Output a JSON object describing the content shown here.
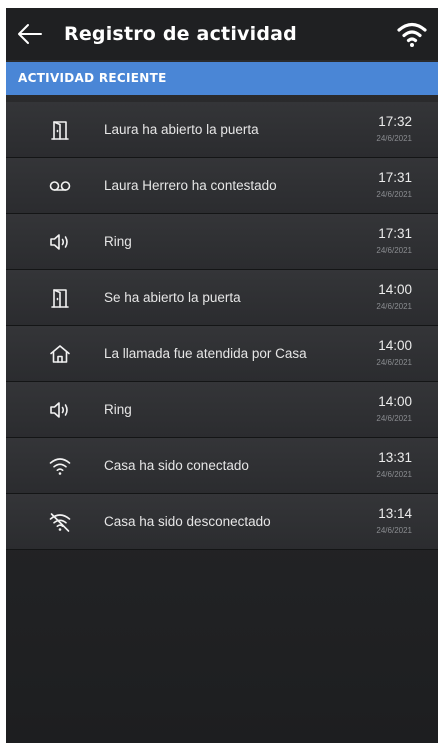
{
  "header": {
    "title": "Registro de actividad",
    "back_icon": "back-arrow-icon",
    "status_icon": "wifi-icon"
  },
  "section": {
    "label": "ACTIVIDAD RECIENTE"
  },
  "colors": {
    "header_bg": "#1f2022",
    "section_bg": "#4a86d6",
    "row_bg": "#303134",
    "text": "#e6e6e6",
    "date_text": "#8a8c90"
  },
  "activity": [
    {
      "icon": "door-open-icon",
      "message": "Laura ha abierto la puerta",
      "time": "17:32",
      "date": "24/6/2021"
    },
    {
      "icon": "voicemail-icon",
      "message": "Laura Herrero ha contestado",
      "time": "17:31",
      "date": "24/6/2021"
    },
    {
      "icon": "speaker-icon",
      "message": "Ring",
      "time": "17:31",
      "date": "24/6/2021"
    },
    {
      "icon": "door-open-icon",
      "message": "Se ha abierto la puerta",
      "time": "14:00",
      "date": "24/6/2021"
    },
    {
      "icon": "home-icon",
      "message": "La llamada fue atendida por Casa",
      "time": "14:00",
      "date": "24/6/2021"
    },
    {
      "icon": "speaker-icon",
      "message": "Ring",
      "time": "14:00",
      "date": "24/6/2021"
    },
    {
      "icon": "wifi-icon",
      "message": "Casa ha sido conectado",
      "time": "13:31",
      "date": "24/6/2021"
    },
    {
      "icon": "wifi-off-icon",
      "message": "Casa ha sido desconectado",
      "time": "13:14",
      "date": "24/6/2021"
    }
  ]
}
